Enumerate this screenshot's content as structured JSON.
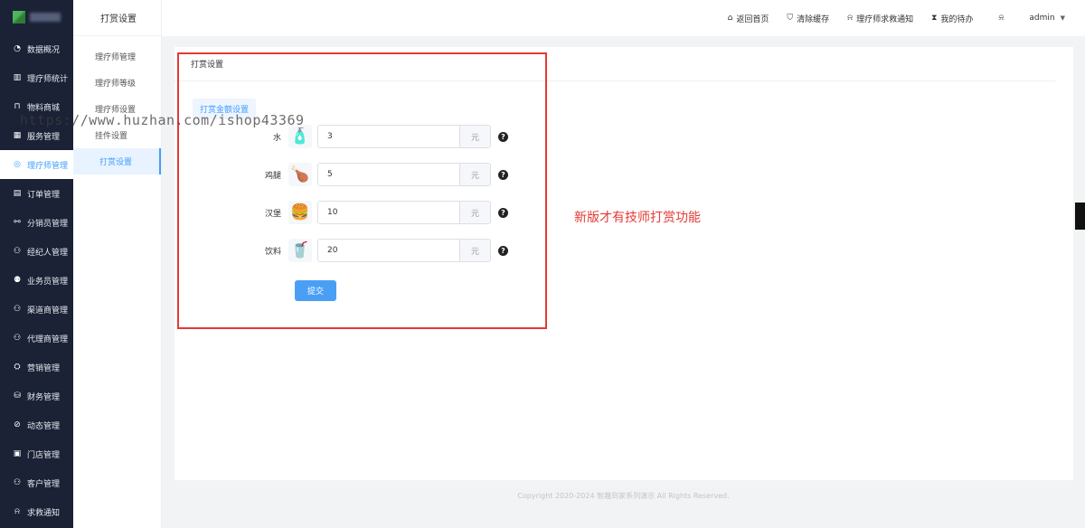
{
  "leftnav": {
    "items": [
      {
        "label": "数据概况",
        "icon": "pie-chart-icon",
        "glyph": "◔"
      },
      {
        "label": "理疗师统计",
        "icon": "bar-chart-icon",
        "glyph": "▥"
      },
      {
        "label": "物料商城",
        "icon": "bag-icon",
        "glyph": "⊓"
      },
      {
        "label": "服务管理",
        "icon": "calendar-icon",
        "glyph": "▦"
      },
      {
        "label": "理疗师管理",
        "icon": "user-circle-icon",
        "glyph": "◎"
      },
      {
        "label": "订单管理",
        "icon": "clipboard-icon",
        "glyph": "▤"
      },
      {
        "label": "分销员管理",
        "icon": "org-icon",
        "glyph": "⚯"
      },
      {
        "label": "经纪人管理",
        "icon": "user-icon",
        "glyph": "⚇"
      },
      {
        "label": "业务员管理",
        "icon": "users-icon",
        "glyph": "⚉"
      },
      {
        "label": "渠道商管理",
        "icon": "user-badge-icon",
        "glyph": "⚇"
      },
      {
        "label": "代理商管理",
        "icon": "user-link-icon",
        "glyph": "⚇"
      },
      {
        "label": "营销管理",
        "icon": "megaphone-icon",
        "glyph": "⛭"
      },
      {
        "label": "财务管理",
        "icon": "money-bag-icon",
        "glyph": "⛁"
      },
      {
        "label": "动态管理",
        "icon": "compass-icon",
        "glyph": "⊘"
      },
      {
        "label": "门店管理",
        "icon": "store-icon",
        "glyph": "▣"
      },
      {
        "label": "客户管理",
        "icon": "customer-icon",
        "glyph": "⚇"
      },
      {
        "label": "求救通知",
        "icon": "bell-icon",
        "glyph": "⍾"
      }
    ],
    "active_index": 4
  },
  "subnav": {
    "title": "打赏设置",
    "items": [
      {
        "label": "理疗师管理"
      },
      {
        "label": "理疗师等级"
      },
      {
        "label": "理疗师设置"
      },
      {
        "label": "挂件设置"
      },
      {
        "label": "打赏设置"
      }
    ],
    "active_index": 4
  },
  "topbar": {
    "home": "返回首页",
    "clear_cache": "清除缓存",
    "sos_notice": "理疗师求救通知",
    "todo": "我的待办",
    "user": "admin"
  },
  "card": {
    "title": "打赏设置",
    "tab": "打赏金额设置",
    "unit": "元",
    "rows": [
      {
        "label": "水",
        "value": "3",
        "icon": "water-bottle-icon",
        "glyph": "🧴"
      },
      {
        "label": "鸡腿",
        "value": "5",
        "icon": "chicken-leg-icon",
        "glyph": "🍗"
      },
      {
        "label": "汉堡",
        "value": "10",
        "icon": "burger-icon",
        "glyph": "🍔"
      },
      {
        "label": "饮料",
        "value": "20",
        "icon": "drink-icon",
        "glyph": "🥤"
      }
    ],
    "submit": "提交"
  },
  "annotation": "新版才有技师打赏功能",
  "watermark": "https://www.huzhan.com/ishop43369",
  "footer": "Copyright 2020-2024 智趣到家系列演示 All Rights Reserved.",
  "colors": {
    "accent": "#409eff",
    "highlight": "#e53935",
    "nav_bg": "#1b2236"
  }
}
